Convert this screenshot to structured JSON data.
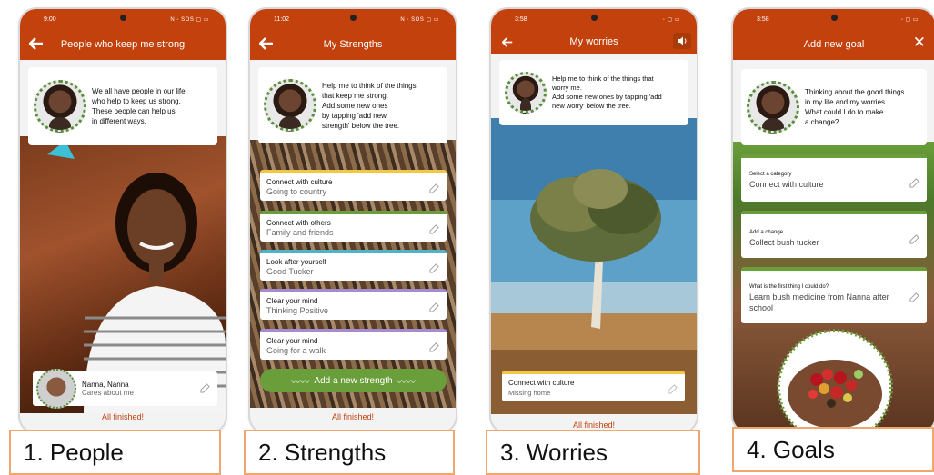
{
  "phones": [
    {
      "status_time": "9:00",
      "status_right": "N ◦ SOS ▢ ▭",
      "title": "People who keep me strong",
      "intro": [
        "We all have people in our life",
        "who help to keep us strong.",
        "These people can help us",
        "in different ways."
      ],
      "person_name": "Nanna, Nanna",
      "person_note": "Cares about me",
      "footer": "All finished!",
      "label": "1. People"
    },
    {
      "status_time": "11:02",
      "status_right": "N ◦ SOS ▢ ▭",
      "title": "My Strengths",
      "intro": [
        "Help me to think of the things",
        "that keep me strong.",
        "Add some new ones",
        "by tapping 'add new",
        "strength' below the tree."
      ],
      "cards": [
        {
          "title": "Connect with culture",
          "sub": "Going to country",
          "color": "#f2c744"
        },
        {
          "title": "Connect with others",
          "sub": "Family and friends",
          "color": "#6a9e3a"
        },
        {
          "title": "Look after yourself",
          "sub": "Good Tucker",
          "color": "#4fb3c9"
        },
        {
          "title": "Clear your mind",
          "sub": "Thinking Positive",
          "color": "#a78bd1"
        },
        {
          "title": "Clear your mind",
          "sub": "Going for a walk",
          "color": "#a78bd1"
        }
      ],
      "button": "Add a new strength",
      "footer": "All finished!",
      "label": "2. Strengths"
    },
    {
      "status_time": "3:58",
      "status_right": "◦ ▢ ▭",
      "title": "My worries",
      "intro": [
        "Help me to think of the things that",
        "worry me.",
        "Add some new ones by tapping 'add",
        "new worry' below the tree."
      ],
      "card": {
        "title": "Connect with culture",
        "sub": "Missing home"
      },
      "footer": "All finished!",
      "label": "3. Worries"
    },
    {
      "status_time": "3:58",
      "status_right": "◦ ▢ ▭",
      "title": "Add new goal",
      "intro": [
        "Thinking about the good things",
        "in my life and my worries",
        "What could I do to make",
        "a change?"
      ],
      "fields": [
        {
          "label": "Select a category",
          "value": "Connect with culture"
        },
        {
          "label": "Add a change",
          "value": "Collect bush tucker"
        },
        {
          "label": "What is the first thing I could do?",
          "value": "Learn bush medicine from Nanna after school"
        }
      ],
      "label": "4. Goals"
    }
  ],
  "colors": {
    "accent": "#c2410c",
    "green": "#6a9e3a"
  },
  "icons": {
    "back": "back-arrow-icon",
    "edit": "edit-icon",
    "close": "close-icon",
    "speaker": "speaker-icon"
  }
}
